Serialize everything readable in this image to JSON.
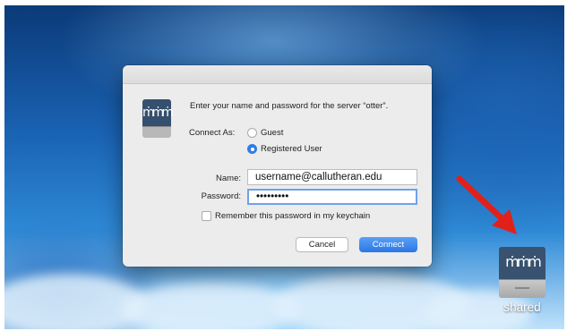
{
  "dialog": {
    "prompt": "Enter your name and password for the server “otter”.",
    "connect_as_label": "Connect As:",
    "options": {
      "guest": "Guest",
      "registered": "Registered User"
    },
    "selected_option": "Registered User",
    "name_label": "Name:",
    "name_value": "username@callutheran.edu",
    "password_label": "Password:",
    "password_value": "•••••••••",
    "remember_label": "Remember this password in my keychain",
    "remember_checked": false,
    "cancel_label": "Cancel",
    "connect_label": "Connect"
  },
  "desktop": {
    "drive_label": "shared",
    "drive_icon": "network-drive-icon",
    "arrow_color": "#e0211b"
  },
  "colors": {
    "accent": "#2f7de6",
    "dialog_bg": "#ececec"
  }
}
